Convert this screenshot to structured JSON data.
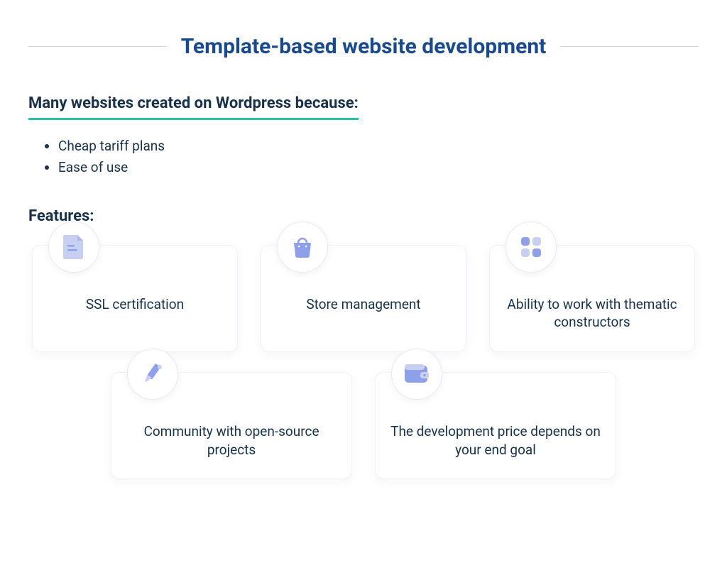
{
  "title": "Template-based website development",
  "subtitle": "Many websites created on Wordpress because:",
  "reasons": [
    "Cheap tariff plans",
    "Ease of use"
  ],
  "features_heading": "Features:",
  "cards": {
    "ssl": "SSL certification",
    "store": "Store management",
    "thematic": "Ability to work with thematic constructors",
    "community": "Community with open-source projects",
    "price": "The development price depends on your end goal"
  },
  "colors": {
    "title": "#194a8d",
    "text": "#17324a",
    "accent_underline": "#29c2a4",
    "icon_primary": "#8ea1e8",
    "icon_light": "#c8d0f2"
  }
}
